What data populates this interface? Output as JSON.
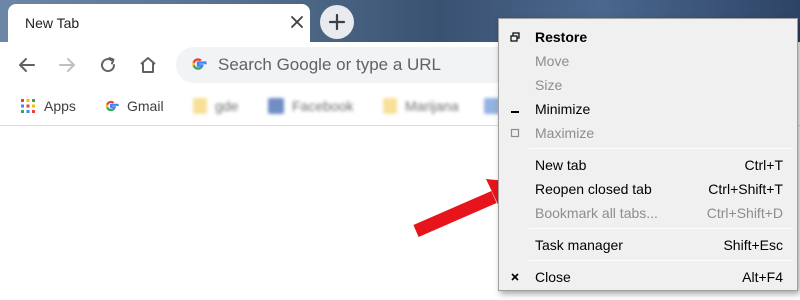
{
  "tab": {
    "title": "New Tab"
  },
  "toolbar": {
    "omnibox_placeholder": "Search Google or type a URL"
  },
  "bookmarks": [
    {
      "label": "Apps",
      "icon": "apps-grid-icon"
    },
    {
      "label": "Gmail",
      "icon": "google-g-icon"
    },
    {
      "label": "gde",
      "icon": "folder-icon",
      "blurred": true
    },
    {
      "label": "Facebook",
      "icon": "facebook-icon",
      "blurred": true
    },
    {
      "label": "Marijana",
      "icon": "folder-icon",
      "blurred": true
    }
  ],
  "menu": {
    "items": [
      {
        "label": "Restore",
        "shortcut": "",
        "enabled": true,
        "bold": true,
        "icon": "restore-icon"
      },
      {
        "label": "Move",
        "shortcut": "",
        "enabled": false
      },
      {
        "label": "Size",
        "shortcut": "",
        "enabled": false
      },
      {
        "label": "Minimize",
        "shortcut": "",
        "enabled": true,
        "icon": "minimize-icon"
      },
      {
        "label": "Maximize",
        "shortcut": "",
        "enabled": false,
        "icon": "maximize-icon"
      },
      {
        "label": "New tab",
        "shortcut": "Ctrl+T",
        "enabled": true
      },
      {
        "label": "Reopen closed tab",
        "shortcut": "Ctrl+Shift+T",
        "enabled": true
      },
      {
        "label": "Bookmark all tabs...",
        "shortcut": "Ctrl+Shift+D",
        "enabled": false
      },
      {
        "label": "Task manager",
        "shortcut": "Shift+Esc",
        "enabled": true
      },
      {
        "label": "Close",
        "shortcut": "Alt+F4",
        "enabled": true,
        "icon": "close-icon"
      }
    ]
  },
  "colors": {
    "annotation_arrow": "#e8141c",
    "menu_background": "#f0f0f0",
    "disabled_text": "#8d8d8d"
  }
}
